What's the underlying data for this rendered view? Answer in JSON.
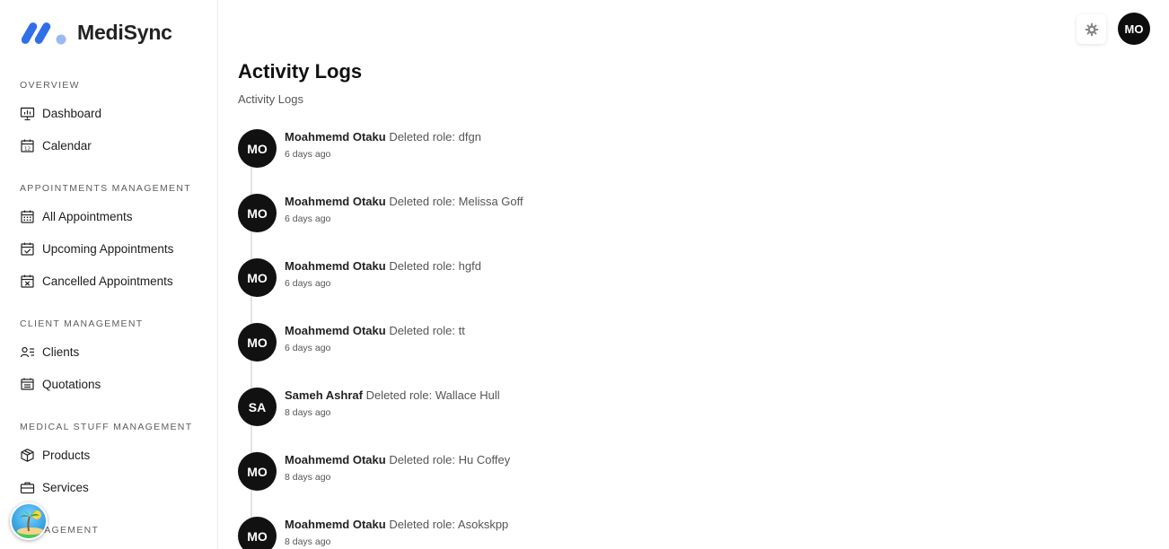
{
  "brand": {
    "name": "MediSync",
    "accent": "#2f6fe8"
  },
  "sidebar": {
    "sections": [
      {
        "title": "OVERVIEW",
        "items": [
          {
            "label": "Dashboard",
            "icon": "presentation-chart-icon"
          },
          {
            "label": "Calendar",
            "icon": "calendar-icon"
          }
        ]
      },
      {
        "title": "APPOINTMENTS MANAGEMENT",
        "items": [
          {
            "label": "All Appointments",
            "icon": "calendar-grid-icon"
          },
          {
            "label": "Upcoming Appointments",
            "icon": "calendar-check-icon"
          },
          {
            "label": "Cancelled Appointments",
            "icon": "calendar-x-icon"
          }
        ]
      },
      {
        "title": "CLIENT MANAGEMENT",
        "items": [
          {
            "label": "Clients",
            "icon": "user-list-icon"
          },
          {
            "label": "Quotations",
            "icon": "receipt-icon"
          }
        ]
      },
      {
        "title": "MEDICAL STUFF MANAGEMENT",
        "items": [
          {
            "label": "Products",
            "icon": "box-icon"
          },
          {
            "label": "Services",
            "icon": "briefcase-icon"
          }
        ]
      },
      {
        "title": "MANAGEMENT",
        "items": []
      }
    ]
  },
  "header": {
    "avatar_initials": "MO",
    "settings_icon": "gear-icon"
  },
  "page": {
    "title": "Activity Logs",
    "breadcrumb": "Activity Logs"
  },
  "logs": [
    {
      "initials": "MO",
      "user": "Moahmemd Otaku",
      "action": "Deleted role: dfgn",
      "time": "6 days ago"
    },
    {
      "initials": "MO",
      "user": "Moahmemd Otaku",
      "action": "Deleted role: Melissa Goff",
      "time": "6 days ago"
    },
    {
      "initials": "MO",
      "user": "Moahmemd Otaku",
      "action": "Deleted role: hgfd",
      "time": "6 days ago"
    },
    {
      "initials": "MO",
      "user": "Moahmemd Otaku",
      "action": "Deleted role: tt",
      "time": "6 days ago"
    },
    {
      "initials": "SA",
      "user": "Sameh Ashraf",
      "action": "Deleted role: Wallace Hull",
      "time": "8 days ago"
    },
    {
      "initials": "MO",
      "user": "Moahmemd Otaku",
      "action": "Deleted role: Hu Coffey",
      "time": "8 days ago"
    },
    {
      "initials": "MO",
      "user": "Moahmemd Otaku",
      "action": "Deleted role: Asokskpp",
      "time": "8 days ago"
    }
  ]
}
